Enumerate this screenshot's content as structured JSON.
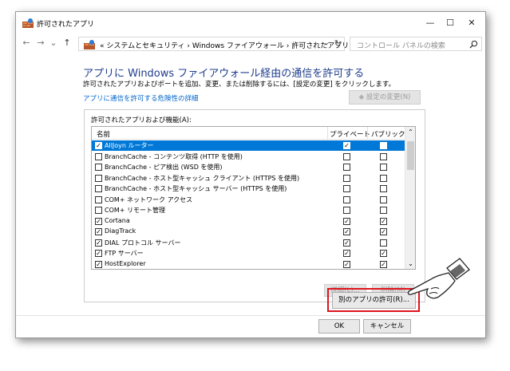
{
  "window": {
    "title": "許可されたアプリ",
    "minimize": "—",
    "maximize": "☐",
    "close": "✕"
  },
  "nav": {
    "back": "←",
    "forward": "→",
    "recent": "⌄",
    "up": "↑"
  },
  "address": {
    "text": "« システムとセキュリティ › Windows ファイアウォール › 許可されたアプリ",
    "dropdown": "⌄",
    "refresh": "↻"
  },
  "search": {
    "placeholder": "コントロール パネルの検索"
  },
  "page": {
    "heading": "アプリに Windows ファイアウォール経由の通信を許可する",
    "description": "許可されたアプリおよびポートを追加、変更、または削除するには、[設定の変更] をクリックします。",
    "risk_link": "アプリに通信を許可する危険性の詳細",
    "change_settings": "設定の変更(N)"
  },
  "group": {
    "label": "許可されたアプリおよび機能(A):",
    "headers": {
      "name": "名前",
      "private": "プライベート",
      "public": "パブリック"
    },
    "rows": [
      {
        "name": "AllJoyn ルーター",
        "enabled": true,
        "private": true,
        "public": false,
        "selected": true
      },
      {
        "name": "BranchCache - コンテンツ取得 (HTTP を使用)",
        "enabled": false,
        "private": false,
        "public": false
      },
      {
        "name": "BranchCache - ピア検出 (WSD を使用)",
        "enabled": false,
        "private": false,
        "public": false
      },
      {
        "name": "BranchCache - ホスト型キャッシュ クライアント (HTTPS を使用)",
        "enabled": false,
        "private": false,
        "public": false
      },
      {
        "name": "BranchCache - ホスト型キャッシュ サーバー (HTTPS を使用)",
        "enabled": false,
        "private": false,
        "public": false
      },
      {
        "name": "COM+ ネットワーク アクセス",
        "enabled": false,
        "private": false,
        "public": false
      },
      {
        "name": "COM+ リモート管理",
        "enabled": false,
        "private": false,
        "public": false
      },
      {
        "name": "Cortana",
        "enabled": true,
        "private": true,
        "public": true
      },
      {
        "name": "DiagTrack",
        "enabled": true,
        "private": true,
        "public": true
      },
      {
        "name": "DIAL プロトコル サーバー",
        "enabled": true,
        "private": true,
        "public": false
      },
      {
        "name": "FTP サーバー",
        "enabled": true,
        "private": true,
        "public": true
      },
      {
        "name": "HostExplorer",
        "enabled": true,
        "private": true,
        "public": true
      }
    ],
    "details_button": "詳細(L)...",
    "remove_button": "削除(M)"
  },
  "allow_another_button": "別のアプリの許可(R)...",
  "ok_button": "OK",
  "cancel_button": "キャンセル",
  "icons": {
    "title": "firewall-icon",
    "search": "search-icon",
    "pointer": "hand-pointer-icon"
  },
  "colors": {
    "highlight": "#e0141e",
    "selection": "#0078d7",
    "heading": "#1e3d8c",
    "link": "#0066cc"
  }
}
